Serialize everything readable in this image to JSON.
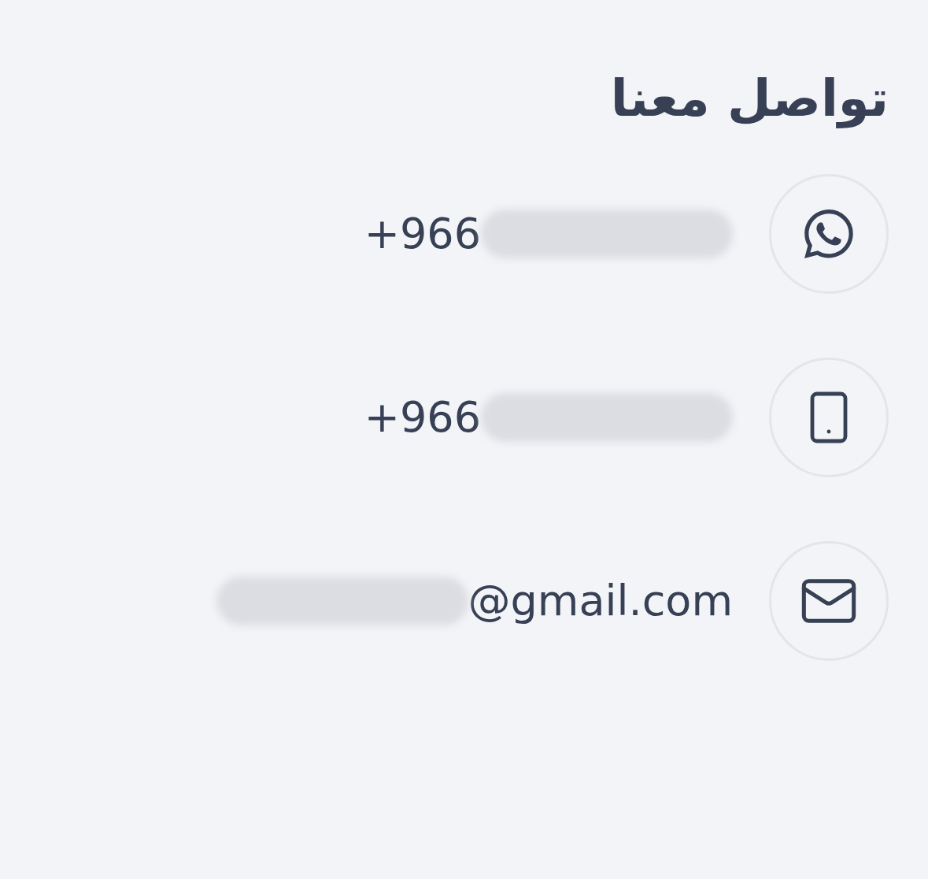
{
  "title": "تواصل معنا",
  "contacts": [
    {
      "kind": "whatsapp",
      "text": "+966"
    },
    {
      "kind": "mobile",
      "text": "+966"
    },
    {
      "kind": "email",
      "text": "@gmail.com"
    }
  ]
}
